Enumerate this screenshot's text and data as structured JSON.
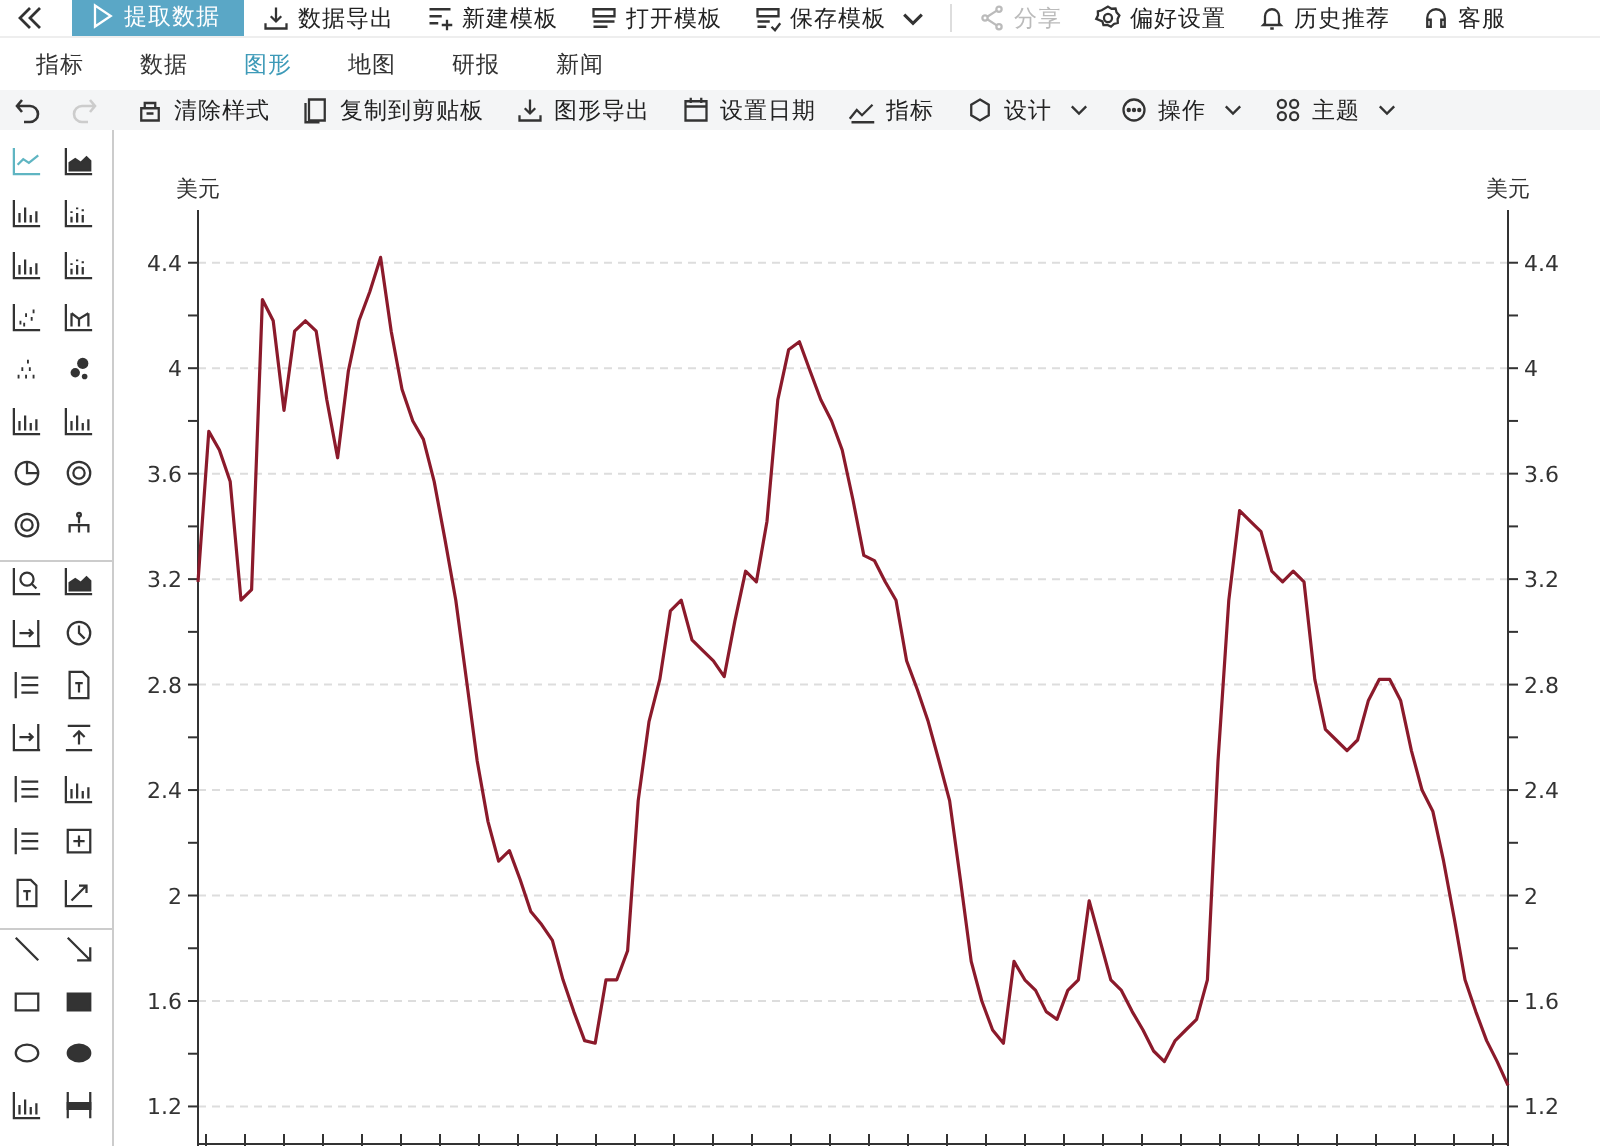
{
  "top_bar": {
    "buttons": [
      {
        "label": "提取数据",
        "kind": "primary",
        "disabled": false,
        "dropdown": false
      },
      {
        "label": "数据导出",
        "kind": "export",
        "disabled": false,
        "dropdown": false
      },
      {
        "label": "新建模板",
        "kind": "new",
        "disabled": false,
        "dropdown": false
      },
      {
        "label": "打开模板",
        "kind": "open",
        "disabled": false,
        "dropdown": false
      },
      {
        "label": "保存模板",
        "kind": "save",
        "disabled": false,
        "dropdown": true
      },
      {
        "label": "分享",
        "kind": "share",
        "disabled": true,
        "dropdown": false
      },
      {
        "label": "偏好设置",
        "kind": "gear",
        "disabled": false,
        "dropdown": false
      },
      {
        "label": "历史推荐",
        "kind": "bell",
        "disabled": false,
        "dropdown": false
      },
      {
        "label": "客服",
        "kind": "headset",
        "disabled": false,
        "dropdown": false
      }
    ]
  },
  "tabs": [
    {
      "label": "指标",
      "selected": false
    },
    {
      "label": "数据",
      "selected": false
    },
    {
      "label": "图形",
      "selected": true
    },
    {
      "label": "地图",
      "selected": false
    },
    {
      "label": "研报",
      "selected": false
    },
    {
      "label": "新闻",
      "selected": false
    }
  ],
  "toolbar": [
    {
      "label": "清除样式",
      "kind": "eraser",
      "dropdown": false
    },
    {
      "label": "复制到剪贴板",
      "kind": "copy",
      "dropdown": false
    },
    {
      "label": "图形导出",
      "kind": "export",
      "dropdown": false
    },
    {
      "label": "设置日期",
      "kind": "calendar",
      "dropdown": false
    },
    {
      "label": "指标",
      "kind": "trend",
      "dropdown": false
    },
    {
      "label": "设计",
      "kind": "design",
      "dropdown": true
    },
    {
      "label": "操作",
      "kind": "dots",
      "dropdown": true
    },
    {
      "label": "主题",
      "kind": "grid",
      "dropdown": true
    }
  ],
  "undo": {
    "disabled": false
  },
  "redo": {
    "disabled": true
  },
  "tool_groups": [
    {
      "tools": [
        {
          "kind": "line-chart",
          "selected": true
        },
        {
          "kind": "area-chart",
          "selected": false
        },
        {
          "kind": "bar-chart",
          "selected": false
        },
        {
          "kind": "bar-dots",
          "selected": false
        },
        {
          "kind": "bar-chart",
          "selected": false
        },
        {
          "kind": "bar-dots",
          "selected": false
        },
        {
          "kind": "scatter-chart",
          "selected": false
        },
        {
          "kind": "combo-chart",
          "selected": false
        },
        {
          "kind": "scatter",
          "selected": false
        },
        {
          "kind": "bubble",
          "selected": false
        },
        {
          "kind": "bar-chart",
          "selected": false
        },
        {
          "kind": "bar-chart",
          "selected": false
        },
        {
          "kind": "pie",
          "selected": false
        },
        {
          "kind": "ring",
          "selected": false
        },
        {
          "kind": "ring",
          "selected": false
        },
        {
          "kind": "tree",
          "selected": false
        }
      ]
    },
    {
      "tools": [
        {
          "kind": "zoom",
          "selected": false
        },
        {
          "kind": "area-chart",
          "selected": false
        },
        {
          "kind": "arrow-box",
          "selected": false
        },
        {
          "kind": "clock",
          "selected": false
        },
        {
          "kind": "list",
          "selected": false
        },
        {
          "kind": "document",
          "selected": false
        },
        {
          "kind": "arrow-box",
          "selected": false
        },
        {
          "kind": "upload",
          "selected": false
        },
        {
          "kind": "list",
          "selected": false
        },
        {
          "kind": "bar-chart",
          "selected": false
        },
        {
          "kind": "list",
          "selected": false
        },
        {
          "kind": "plus-box",
          "selected": false
        },
        {
          "kind": "document",
          "selected": false
        },
        {
          "kind": "trend-arrow",
          "selected": false
        }
      ]
    },
    {
      "tools": [
        {
          "kind": "line",
          "selected": false
        },
        {
          "kind": "arrow-line",
          "selected": false
        },
        {
          "kind": "rect",
          "selected": false
        },
        {
          "kind": "filled-rect",
          "selected": false
        },
        {
          "kind": "ellipse",
          "selected": false
        },
        {
          "kind": "filled-ellipse",
          "selected": false
        },
        {
          "kind": "bar-chart",
          "selected": false
        },
        {
          "kind": "stack",
          "selected": false
        }
      ]
    }
  ],
  "chart": {
    "chart_data": {
      "type": "line",
      "ylabel": "美元",
      "ylim": [
        1.05,
        4.6
      ],
      "yticks": [
        1.2,
        1.6,
        2,
        2.4,
        2.8,
        3.2,
        3.6,
        4,
        4.4
      ],
      "grid": true,
      "series": [
        {
          "color": "#8b1a2b",
          "values": [
            3.19,
            3.76,
            3.69,
            3.57,
            3.12,
            3.16,
            4.26,
            4.18,
            3.84,
            4.14,
            4.18,
            4.14,
            3.88,
            3.66,
            3.99,
            4.18,
            4.29,
            4.42,
            4.14,
            3.92,
            3.8,
            3.73,
            3.57,
            3.35,
            3.12,
            2.82,
            2.51,
            2.28,
            2.13,
            2.17,
            2.06,
            1.94,
            1.89,
            1.83,
            1.68,
            1.56,
            1.45,
            1.44,
            1.68,
            1.68,
            1.79,
            2.36,
            2.66,
            2.82,
            3.08,
            3.12,
            2.97,
            2.93,
            2.89,
            2.83,
            3.04,
            3.23,
            3.19,
            3.42,
            3.88,
            4.07,
            4.1,
            3.99,
            3.88,
            3.8,
            3.69,
            3.5,
            3.29,
            3.27,
            3.19,
            3.12,
            2.89,
            2.78,
            2.66,
            2.51,
            2.36,
            2.06,
            1.75,
            1.6,
            1.49,
            1.44,
            1.75,
            1.68,
            1.64,
            1.56,
            1.53,
            1.64,
            1.68,
            1.98,
            1.83,
            1.68,
            1.64,
            1.56,
            1.49,
            1.41,
            1.37,
            1.45,
            1.49,
            1.53,
            1.68,
            2.51,
            3.12,
            3.46,
            3.42,
            3.38,
            3.23,
            3.19,
            3.23,
            3.19,
            2.82,
            2.63,
            2.59,
            2.55,
            2.59,
            2.74,
            2.82,
            2.82,
            2.74,
            2.55,
            2.4,
            2.32,
            2.13,
            1.91,
            1.68,
            1.56,
            1.45,
            1.37,
            1.28
          ]
        }
      ]
    },
    "right_axis": {
      "label": "美元",
      "ticks": [
        "4.4",
        "4",
        "3.6",
        "3.2",
        "2.8",
        "2.4",
        "2",
        "1.6",
        "1.2"
      ]
    }
  }
}
